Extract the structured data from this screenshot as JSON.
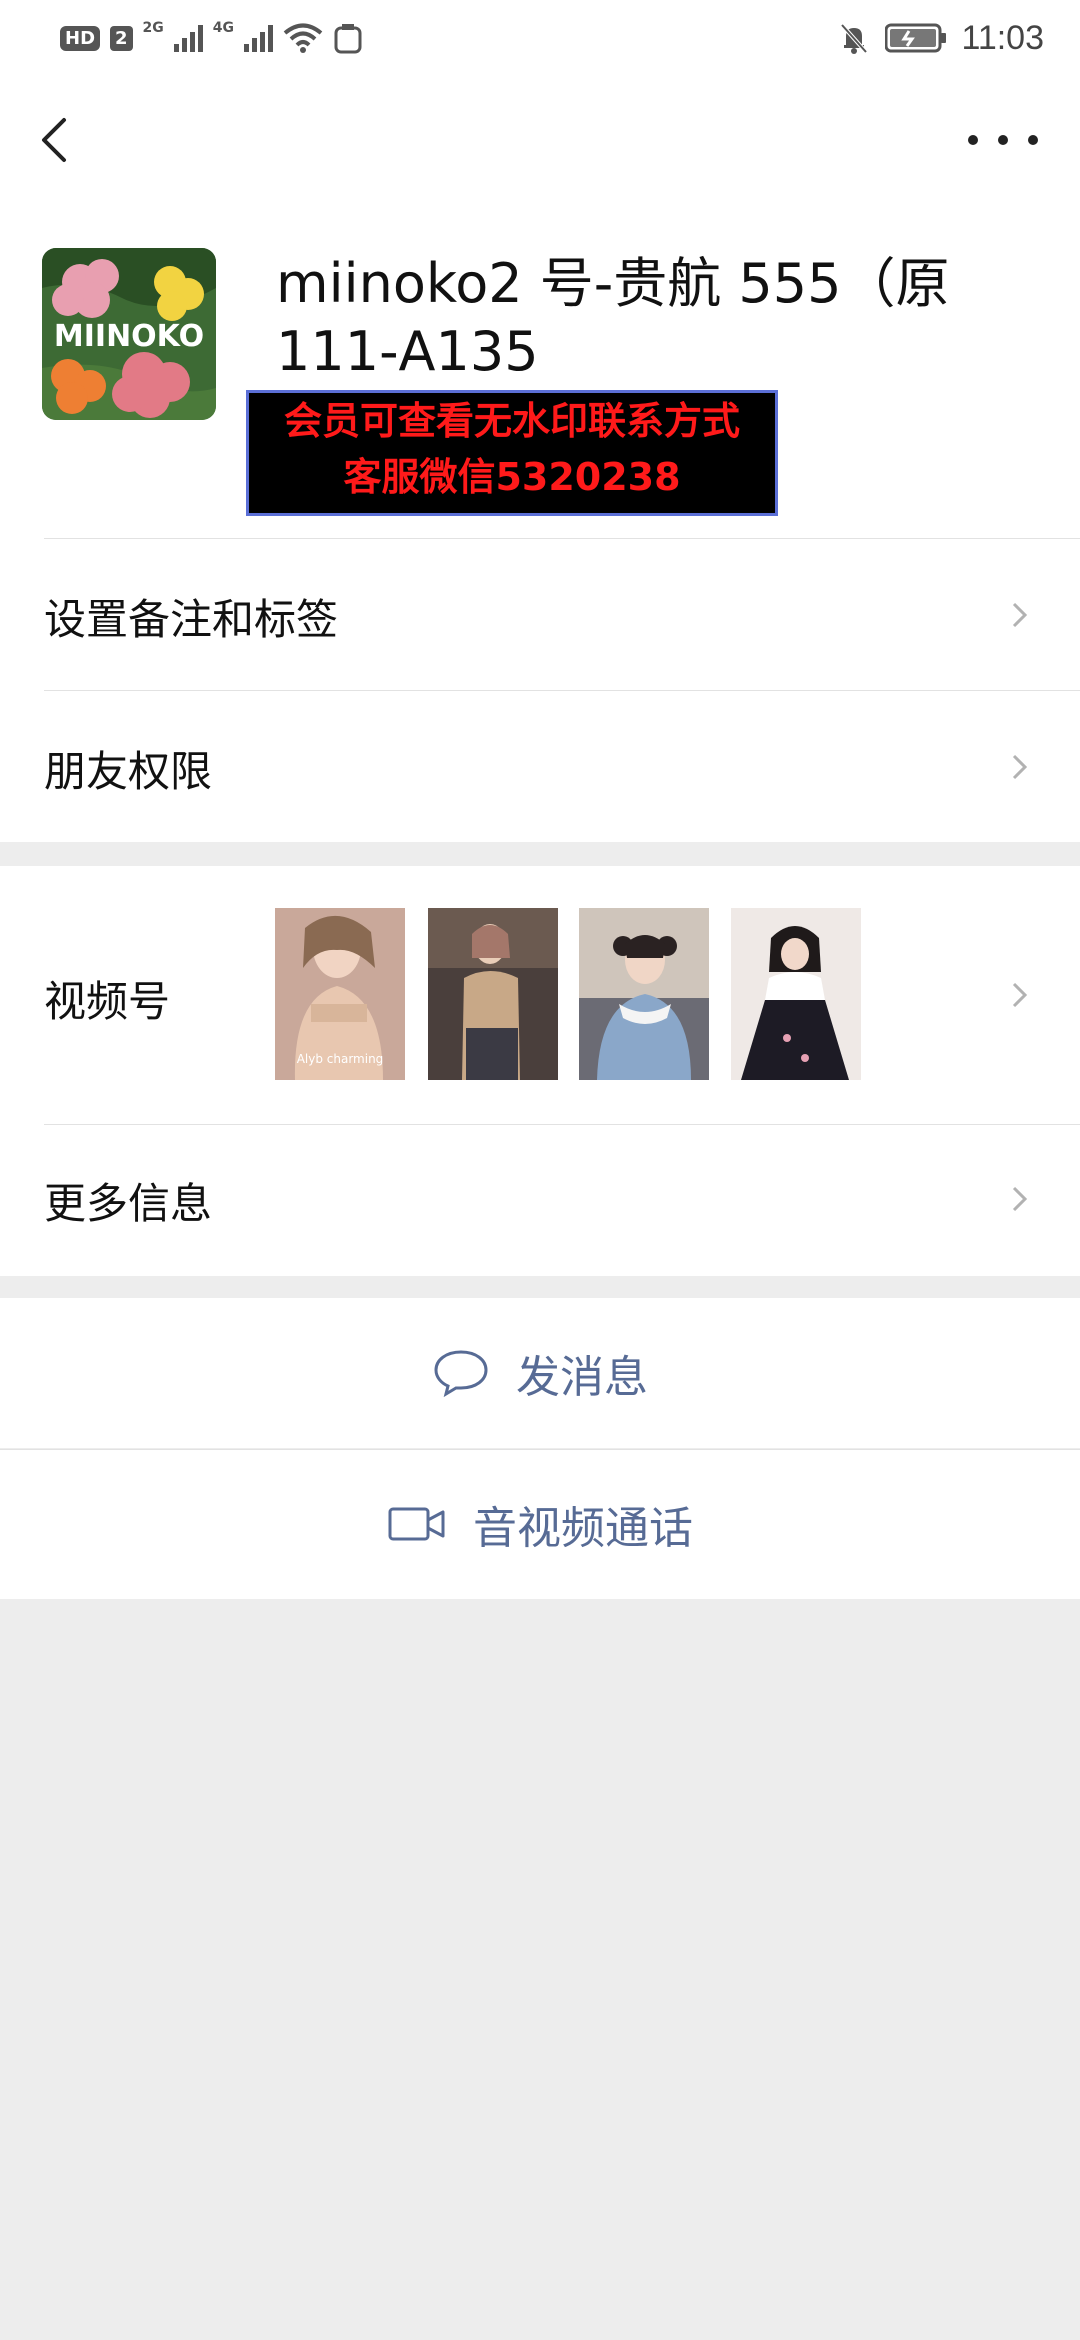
{
  "status_bar": {
    "hd": "HD",
    "sim": "2",
    "net1": "2G",
    "net2": "4G",
    "time": "11:03"
  },
  "profile": {
    "name": "miinoko2 号-贵航 555（原 111-A135",
    "avatar_text": "MIINOKO"
  },
  "watermark": {
    "line1": "会员可查看无水印联系方式",
    "line2": "客服微信5320238"
  },
  "menu": {
    "remark": "设置备注和标签",
    "permissions": "朋友权限",
    "channels": "视频号",
    "more_info": "更多信息"
  },
  "channels_thumbs": [
    {
      "caption": "Alyb charming"
    },
    {
      "caption": ""
    },
    {
      "caption": ""
    },
    {
      "caption": ""
    }
  ],
  "actions": {
    "message": "发消息",
    "call": "音视频通话"
  },
  "colors": {
    "link": "#576b95",
    "watermark_text": "#ff1a1a",
    "page_bg": "#ededed"
  }
}
